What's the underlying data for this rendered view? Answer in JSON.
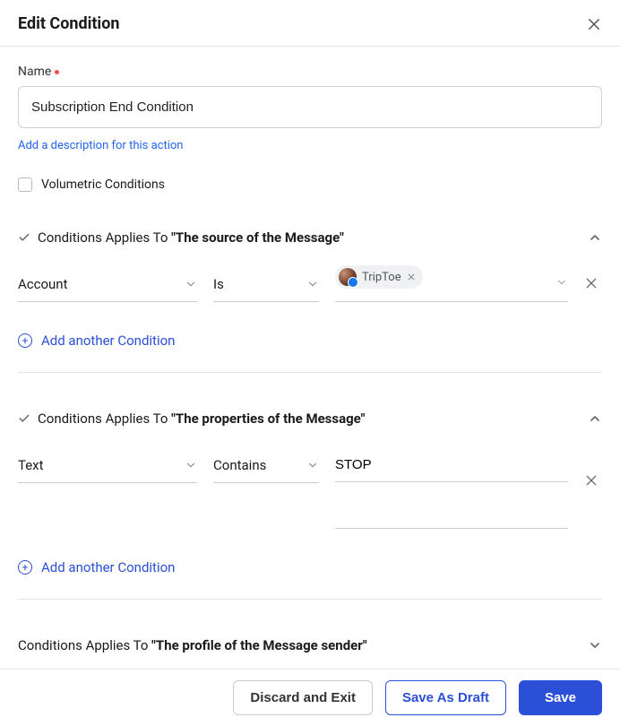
{
  "header": {
    "title": "Edit Condition"
  },
  "name": {
    "label": "Name",
    "value": "Subscription End Condition"
  },
  "add_description_link": "Add a description for this action",
  "volumetric": {
    "label": "Volumetric Conditions",
    "checked": false
  },
  "sections": {
    "source": {
      "prefix": "Conditions Applies To ",
      "topic": "\"The source of the Message\"",
      "field": "Account",
      "operator": "Is",
      "value_chip": "TripToe",
      "add_label": "Add another Condition"
    },
    "properties": {
      "prefix": "Conditions Applies To ",
      "topic": "\"The properties of the Message\"",
      "field": "Text",
      "operator": "Contains",
      "value": "STOP",
      "add_label": "Add another Condition"
    },
    "profile": {
      "prefix": "Conditions Applies To ",
      "topic": "\"The profile of the Message sender\""
    }
  },
  "footer": {
    "discard": "Discard and Exit",
    "draft": "Save As Draft",
    "save": "Save"
  }
}
